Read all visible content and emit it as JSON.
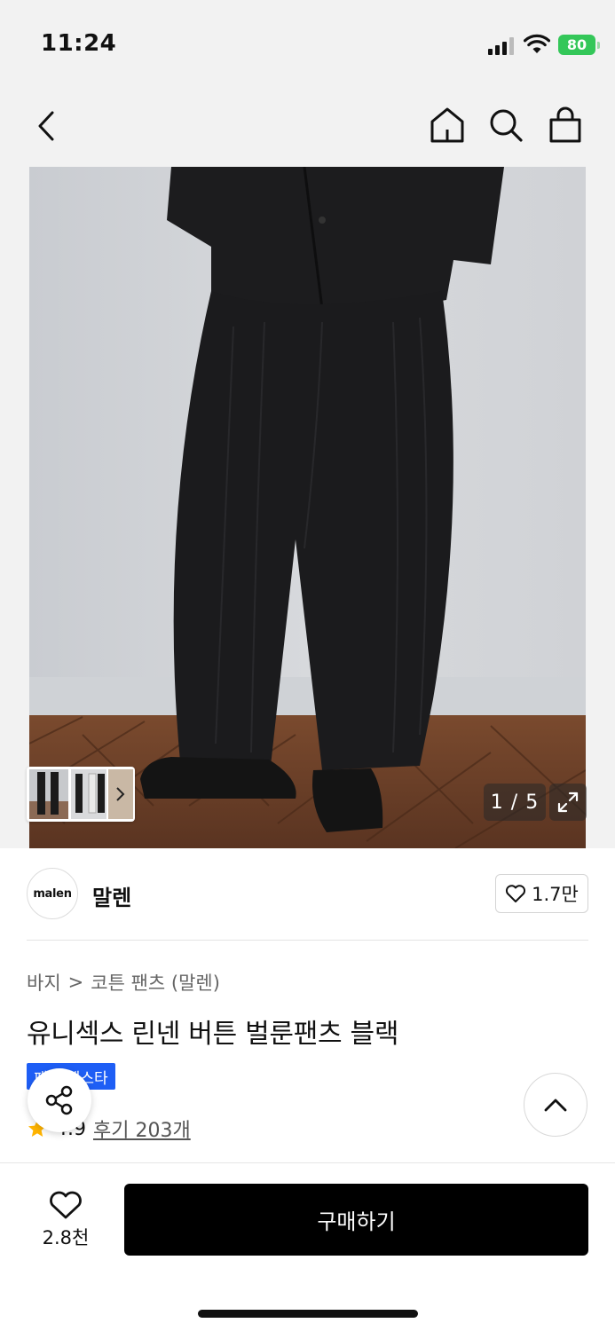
{
  "status_bar": {
    "time": "11:24",
    "battery": "80",
    "icons": [
      "signal-icon",
      "wifi-icon",
      "battery-icon"
    ]
  },
  "nav": {
    "icons": [
      "back-icon",
      "home-icon",
      "search-icon",
      "shopping-bag-icon"
    ]
  },
  "gallery": {
    "counter": "1 / 5",
    "expand_icon": "expand-icon",
    "thumbnail_next_icon": "chevron-right-icon"
  },
  "brand": {
    "logo_text": "malen",
    "name": "말렌",
    "likes": "1.7만"
  },
  "breadcrumb": {
    "category": "바지",
    "separator": ">",
    "subcategory": "코튼 팬츠 (말렌)"
  },
  "product": {
    "title": "유니섹스 린넨 버튼 벌룬팬츠 블랙",
    "badge": "패션 페스타",
    "rating": "4.9",
    "reviews": "후기 203개"
  },
  "bottom": {
    "wish_count": "2.8천",
    "buy_label": "구매하기"
  },
  "colors": {
    "accent_blue": "#1e5ef5",
    "star": "#ffb400",
    "battery_green": "#34c759",
    "buy_button": "#000000"
  }
}
